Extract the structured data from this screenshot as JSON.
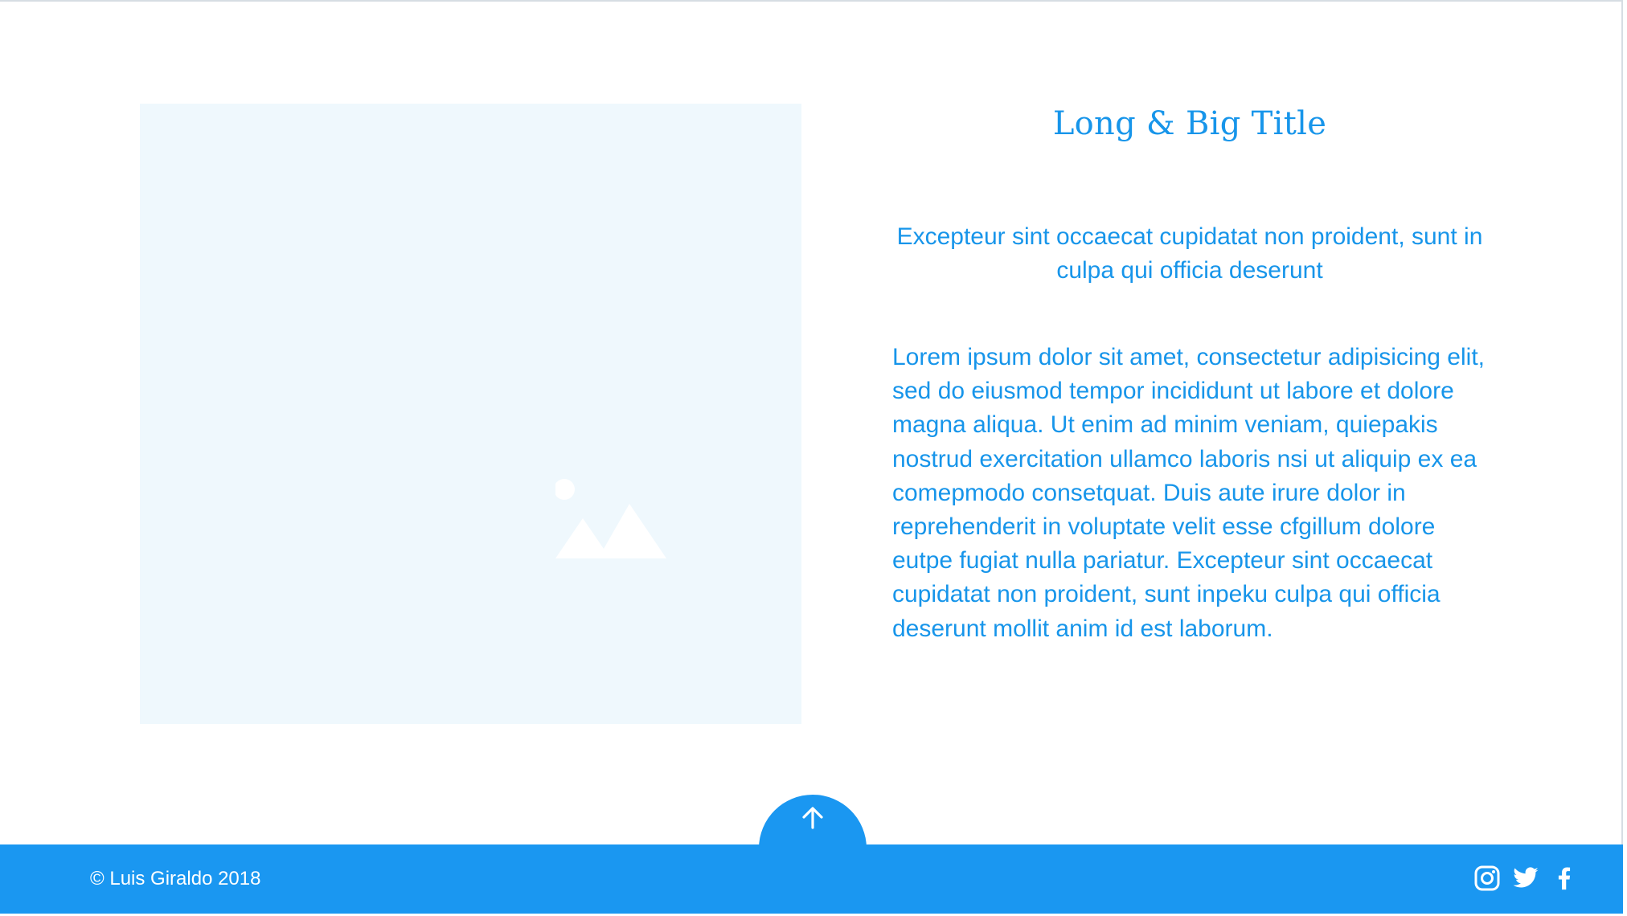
{
  "hero": {
    "title": "Long & Big Title",
    "subtitle": "Excepteur sint occaecat cupidatat non proident, sunt in culpa qui officia deserunt",
    "body": "Lorem ipsum dolor sit amet, consectetur adipisicing elit, sed do eiusmod tempor incididunt ut labore et dolore magna aliqua. Ut enim ad minim veniam, quiepakis nostrud exercitation ullamco laboris nsi ut aliquip ex ea comepmodo consetquat. Duis aute irure dolor in reprehenderit in voluptate velit esse cfgillum dolore eutpe fugiat nulla pariatur. Excepteur sint occaecat cupidatat non proident, sunt inpeku culpa qui officia deserunt mollit anim id est laborum.",
    "image_icon": "image-placeholder-icon"
  },
  "scroll_top": {
    "icon": "arrow-up-icon"
  },
  "footer": {
    "copyright": "© Luis Giraldo 2018",
    "social": [
      {
        "name": "instagram",
        "icon": "instagram-icon"
      },
      {
        "name": "twitter",
        "icon": "twitter-icon"
      },
      {
        "name": "facebook",
        "icon": "facebook-icon"
      }
    ]
  },
  "colors": {
    "accent": "#1a97f1",
    "text": "#1795ea",
    "placeholder_bg": "#eff8fd",
    "background": "#ffffff"
  }
}
